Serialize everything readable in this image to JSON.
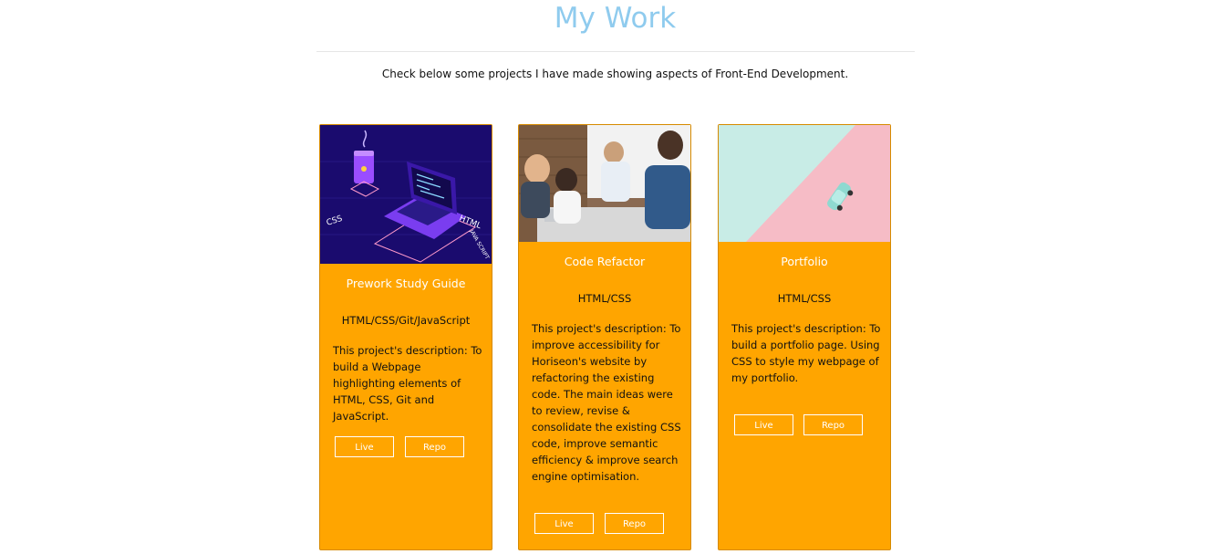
{
  "header": {
    "title": "My Work",
    "intro": "Check below some projects I have made showing aspects of Front-End Development."
  },
  "projects": [
    {
      "title": "Prework Study Guide",
      "tech": "HTML/CSS/Git/JavaScript",
      "description": "This project's description: To build a Webpage highlighting elements of HTML, CSS, Git and JavaScript.",
      "live_label": "Live",
      "repo_label": "Repo",
      "image_labels": [
        "CSS",
        "HTML",
        "JAVA SCRIPT"
      ]
    },
    {
      "title": "Code Refactor",
      "tech": "HTML/CSS",
      "description": "This project's description: To improve accessibility for Horiseon's website by refactoring the existing code. The main ideas were to review, revise & consolidate the existing CSS code, improve semantic efficiency & improve search engine optimisation.",
      "live_label": "Live",
      "repo_label": "Repo"
    },
    {
      "title": "Portfolio",
      "tech": "HTML/CSS",
      "description": "This project's description: To build a portfolio page. Using CSS to style my webpage of my portfolio.",
      "live_label": "Live",
      "repo_label": "Repo"
    }
  ],
  "colors": {
    "title": "#8fcbee",
    "card_background": "#ffa500",
    "card_text_light": "#ffffff",
    "card_text_dark": "#111111"
  }
}
